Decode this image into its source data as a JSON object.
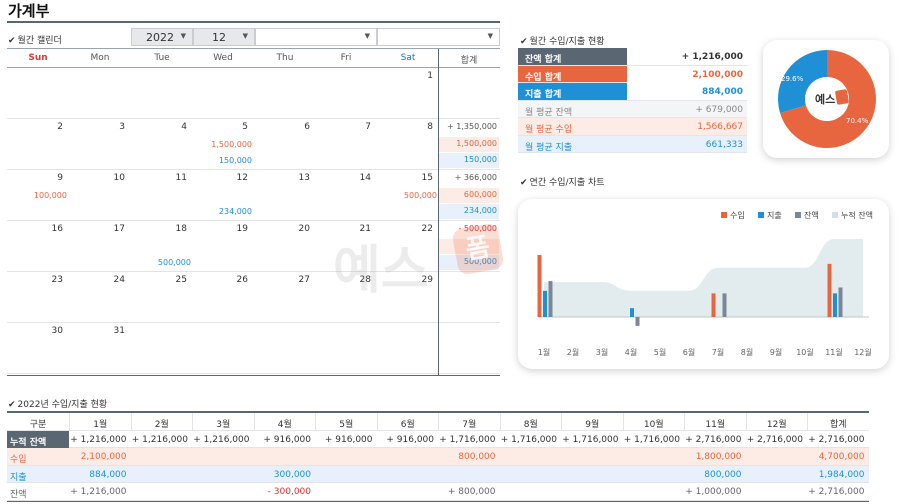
{
  "app_title": "가계부",
  "calendar": {
    "section_label": "월간 캘린더",
    "year": "2022",
    "month": "12",
    "weekdays": [
      "Sun",
      "Mon",
      "Tue",
      "Wed",
      "Thu",
      "Fri",
      "Sat",
      "합계"
    ],
    "weeks": [
      {
        "days": [
          "",
          "",
          "",
          "",
          "",
          "",
          "1"
        ],
        "income": [
          "",
          "",
          "",
          "",
          "",
          "",
          ""
        ],
        "expense": [
          "",
          "",
          "",
          "",
          "",
          "",
          ""
        ],
        "total": {
          "balance": "",
          "income": "",
          "expense": ""
        }
      },
      {
        "days": [
          "2",
          "3",
          "4",
          "5",
          "6",
          "7",
          "8"
        ],
        "income": [
          "",
          "",
          "",
          "1,500,000",
          "",
          "",
          ""
        ],
        "expense": [
          "",
          "",
          "",
          "150,000",
          "",
          "",
          ""
        ],
        "total": {
          "balance": "+ 1,350,000",
          "income": "1,500,000",
          "expense": "150,000"
        }
      },
      {
        "days": [
          "9",
          "10",
          "11",
          "12",
          "13",
          "14",
          "15"
        ],
        "income": [
          "100,000",
          "",
          "",
          "",
          "",
          "",
          "500,000"
        ],
        "expense": [
          "",
          "",
          "",
          "234,000",
          "",
          "",
          ""
        ],
        "total": {
          "balance": "+ 366,000",
          "income": "600,000",
          "expense": "234,000"
        }
      },
      {
        "days": [
          "16",
          "17",
          "18",
          "19",
          "20",
          "21",
          "22"
        ],
        "income": [
          "",
          "",
          "",
          "",
          "",
          "",
          ""
        ],
        "expense": [
          "",
          "",
          "500,000",
          "",
          "",
          "",
          ""
        ],
        "total": {
          "balance": "- 500,000",
          "income": "",
          "expense": "500,000"
        }
      },
      {
        "days": [
          "23",
          "24",
          "25",
          "26",
          "27",
          "28",
          "29"
        ],
        "income": [
          "",
          "",
          "",
          "",
          "",
          "",
          ""
        ],
        "expense": [
          "",
          "",
          "",
          "",
          "",
          "",
          ""
        ],
        "total": {
          "balance": "",
          "income": "",
          "expense": ""
        }
      },
      {
        "days": [
          "30",
          "31",
          "",
          "",
          "",
          "",
          ""
        ],
        "income": [
          "",
          "",
          "",
          "",
          "",
          "",
          ""
        ],
        "expense": [
          "",
          "",
          "",
          "",
          "",
          "",
          ""
        ],
        "total": {
          "balance": "",
          "income": "",
          "expense": ""
        }
      }
    ]
  },
  "summary": {
    "section_label": "월간 수입/지출 현황",
    "rows": [
      {
        "label": "잔액 합계",
        "value": "+ 1,216,000"
      },
      {
        "label": "수입 합계",
        "value": "2,100,000"
      },
      {
        "label": "지출 합계",
        "value": "884,000"
      },
      {
        "label": "월 평균 잔액",
        "value": "+ 679,000"
      },
      {
        "label": "월 평균 수입",
        "value": "1,566,667"
      },
      {
        "label": "월 평균 지출",
        "value": "661,333"
      }
    ]
  },
  "donut": {
    "income_pct": "70.4%",
    "expense_pct": "29.6%",
    "income_value": 70.4,
    "expense_value": 29.6,
    "logo_text": "예스",
    "logo_badge": "폼"
  },
  "yearly_chart": {
    "section_label": "연간 수입/지출 차트",
    "legend": [
      "수입",
      "지출",
      "잔액",
      "누적 잔액"
    ],
    "colors": {
      "income": "#e8663f",
      "expense": "#1f8fd6",
      "balance": "#7b8794",
      "cumulative": "#cfe0e4"
    }
  },
  "chart_data": {
    "type": "bar",
    "categories": [
      "1월",
      "2월",
      "3월",
      "4월",
      "5월",
      "6월",
      "7월",
      "8월",
      "9월",
      "10월",
      "11월",
      "12월"
    ],
    "series": [
      {
        "name": "수입",
        "values": [
          2100000,
          0,
          0,
          0,
          0,
          0,
          800000,
          0,
          0,
          0,
          1800000,
          0
        ]
      },
      {
        "name": "지출",
        "values": [
          884000,
          0,
          0,
          300000,
          0,
          0,
          0,
          0,
          0,
          0,
          800000,
          0
        ]
      },
      {
        "name": "잔액",
        "values": [
          1216000,
          0,
          0,
          -300000,
          0,
          0,
          800000,
          0,
          0,
          0,
          1000000,
          0
        ]
      },
      {
        "name": "누적 잔액",
        "values": [
          1216000,
          1216000,
          1216000,
          916000,
          916000,
          916000,
          1716000,
          1716000,
          1716000,
          1716000,
          2716000,
          2716000
        ]
      }
    ],
    "legend_position": "top-right"
  },
  "yearly_table": {
    "section_label": "2022년 수입/지출 현황",
    "headers": [
      "구분",
      "1월",
      "2월",
      "3월",
      "4월",
      "5월",
      "6월",
      "7월",
      "8월",
      "9월",
      "10월",
      "11월",
      "12월",
      "합계"
    ],
    "rows": [
      {
        "label": "누적 잔액",
        "cells": [
          "+ 1,216,000",
          "+ 1,216,000",
          "+ 1,216,000",
          "+ 916,000",
          "+ 916,000",
          "+ 916,000",
          "+ 1,716,000",
          "+ 1,716,000",
          "+ 1,716,000",
          "+ 1,716,000",
          "+ 2,716,000",
          "+ 2,716,000",
          "+ 2,716,000"
        ]
      },
      {
        "label": "수입",
        "cells": [
          "2,100,000",
          "",
          "",
          "",
          "",
          "",
          "800,000",
          "",
          "",
          "",
          "1,800,000",
          "",
          "4,700,000"
        ]
      },
      {
        "label": "지출",
        "cells": [
          "884,000",
          "",
          "",
          "300,000",
          "",
          "",
          "",
          "",
          "",
          "",
          "800,000",
          "",
          "1,984,000"
        ]
      },
      {
        "label": "잔액",
        "cells": [
          "+ 1,216,000",
          "",
          "",
          "- 300,000",
          "",
          "",
          "+ 800,000",
          "",
          "",
          "",
          "+ 1,000,000",
          "",
          "+ 2,716,000"
        ]
      }
    ]
  }
}
